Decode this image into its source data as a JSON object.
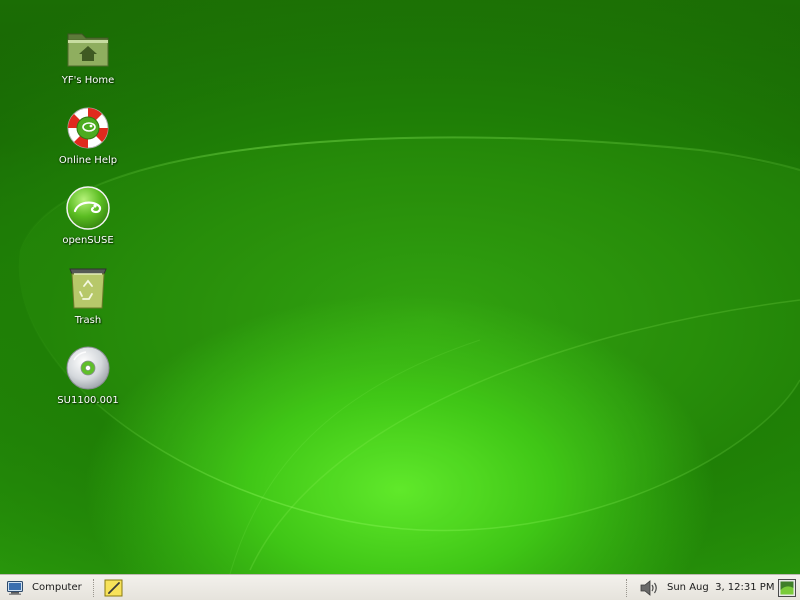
{
  "desktop": {
    "icons": [
      {
        "name": "home-folder",
        "label": "YF's Home",
        "icon": "home-folder-icon"
      },
      {
        "name": "online-help",
        "label": "Online Help",
        "icon": "lifebuoy-icon"
      },
      {
        "name": "opensuse",
        "label": "openSUSE",
        "icon": "opensuse-logo-icon"
      },
      {
        "name": "trash",
        "label": "Trash",
        "icon": "trash-icon"
      },
      {
        "name": "cd-disc",
        "label": "SU1100.001",
        "icon": "cd-disc-icon"
      }
    ]
  },
  "taskbar": {
    "computer_label": "Computer",
    "clock": "Sun Aug  3, 12:31 PM",
    "icons": [
      "computer-icon",
      "notes-icon",
      "volume-icon",
      "show-desktop-icon"
    ]
  },
  "colors": {
    "desktop_dark": "#176304",
    "desktop_light": "#5fe82a",
    "taskbar_bg": "#ebe8e2"
  }
}
